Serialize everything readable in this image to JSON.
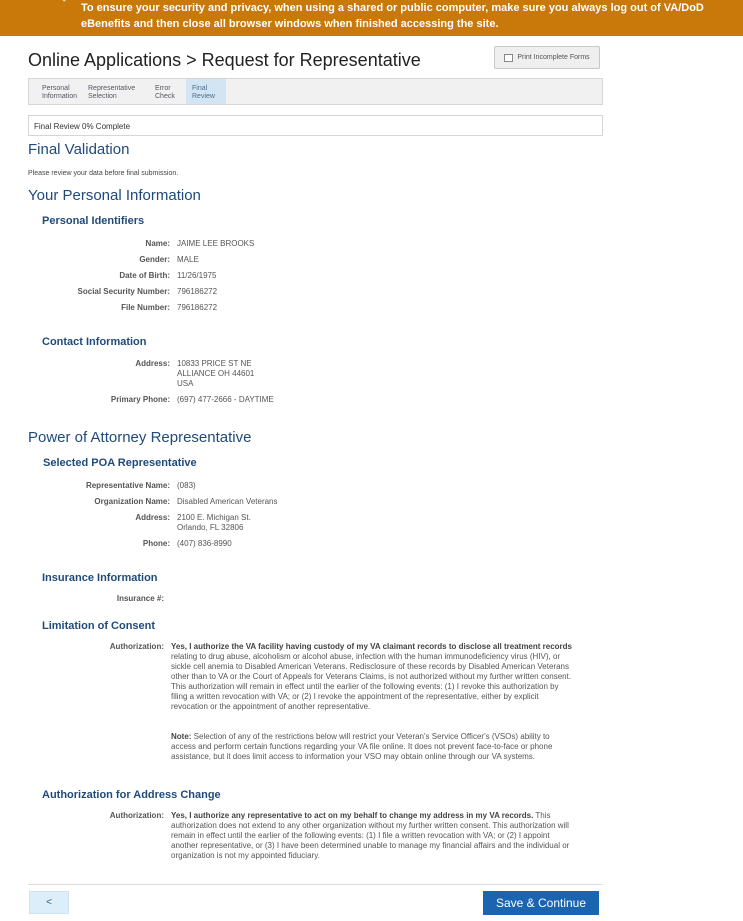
{
  "banner": {
    "text": "To ensure your security and privacy, when using a shared or public computer, make sure you always log out of VA/DoD eBenefits and then close all browser windows when finished accessing the site.",
    "color": "#c8790a"
  },
  "header": {
    "title": "Online Applications > Request for Representative",
    "print_label": "Print Incomplete Forms"
  },
  "steps": [
    {
      "label": "Personal\nInformation"
    },
    {
      "label": "Representative\nSelection"
    },
    {
      "label": "Error\nCheck"
    },
    {
      "label": "Final\nReview",
      "active": true
    }
  ],
  "progress": {
    "text": "Final Review 0% Complete"
  },
  "validation": {
    "title": "Final Validation",
    "note": "Please review your data before final submission."
  },
  "personal": {
    "title": "Your Personal Information",
    "identifiers": {
      "title": "Personal Identifiers",
      "name_label": "Name:",
      "name": "JAIME LEE BROOKS",
      "gender_label": "Gender:",
      "gender": "MALE",
      "dob_label": "Date of Birth:",
      "dob": "11/26/1975",
      "ssn_label": "Social Security Number:",
      "ssn": "796186272",
      "file_label": "File Number:",
      "file": "796186272"
    },
    "contact": {
      "title": "Contact Information",
      "address_label": "Address:",
      "address": "10833 PRICE ST NE\nALLIANCE OH 44601\nUSA",
      "phone_label": "Primary Phone:",
      "phone": "(697) 477-2666 - DAYTIME"
    }
  },
  "poa": {
    "title": "Power of Attorney Representative",
    "selected": {
      "title": "Selected POA Representative",
      "rep_label": "Representative Name:",
      "rep": "(083)",
      "org_label": "Organization Name:",
      "org": "Disabled American Veterans",
      "address_label": "Address:",
      "address": "2100 E. Michigan St.\nOrlando, FL 32806",
      "phone_label": "Phone:",
      "phone": "(407) 836-8990"
    },
    "insurance": {
      "title": "Insurance Information",
      "label": "Insurance #:"
    },
    "consent": {
      "title": "Limitation of Consent",
      "label": "Authorization:",
      "bold": "Yes, I authorize the VA facility having custody of my VA claimant records to disclose all treatment records",
      "text": " relating to drug abuse, alcoholism or alcohol abuse, infection with the human immunodeficiency virus (HIV), or sickle cell anemia to Disabled American Veterans. Redisclosure of these records by Disabled American Veterans other than to VA or the Court of Appeals for Veterans Claims, is not authorized without my further written consent. This authorization will remain in effect until the earlier of the following events: (1) I revoke this authorization by filing a written revocation with VA; or (2) I revoke the appointment of the representative, either by explicit revocation or the appointment of another representative.",
      "note_bold": "Note:",
      "note_text": " Selection of any of the restrictions below will restrict your Veteran's Service Officer's (VSOs) ability to access and perform certain functions regarding your VA file online. It does not prevent face-to-face or phone assistance, but it does limit access to information your VSO may obtain online through our VA systems."
    },
    "address_change": {
      "title": "Authorization for Address Change",
      "label": "Authorization:",
      "bold": "Yes, I authorize any representative to act on my behalf to change my address in my VA records.",
      "text": " This authorization does not extend to any other organization without my further written consent. This authorization will remain in effect until the earlier of the following events: (1) I file a written revocation with VA; or (2) I appoint another representative, or (3) I have been determined unable to manage my financial affairs and the individual or organization is not my appointed fiduciary."
    }
  },
  "footer": {
    "back_label": "<",
    "save_label": "Save & Continue",
    "save_color": "#1b64b0"
  }
}
